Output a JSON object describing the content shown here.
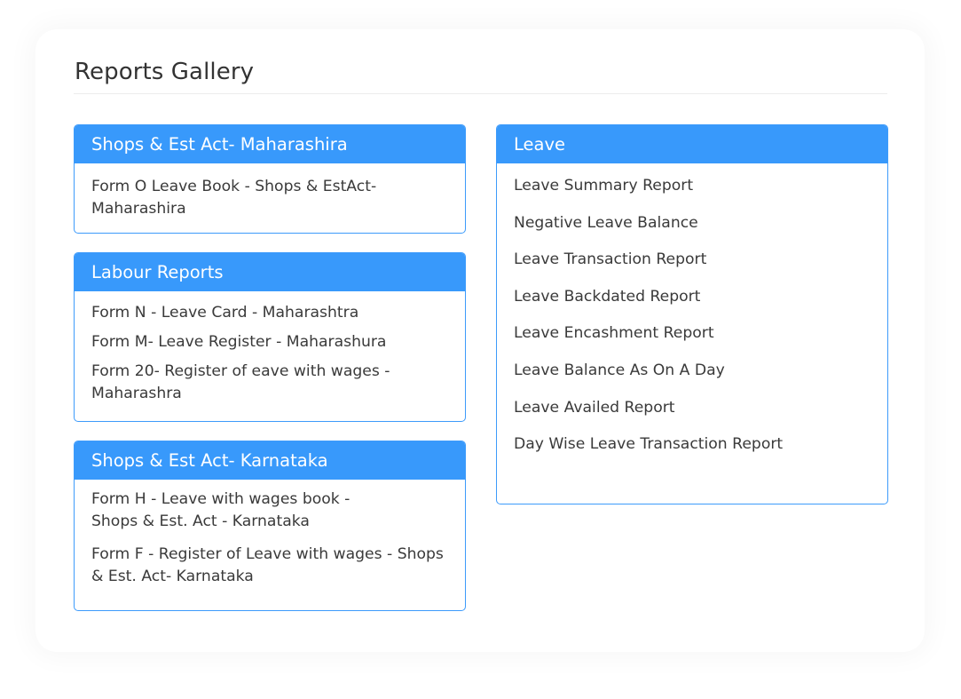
{
  "page": {
    "title": "Reports Gallery"
  },
  "colors": {
    "accent": "#3899fb",
    "border": "#3d9bfb",
    "text": "#3a3a3a"
  },
  "sections": [
    {
      "title": "Shops & Est Act- Maharashira",
      "items": [
        "Form O Leave Book - Shops & EstAct- Maharashira"
      ]
    },
    {
      "title": "Labour Reports",
      "items": [
        "Form N - Leave Card - Maharashtra",
        "Form M- Leave Register - Maharashura",
        "Form 20- Register of eave with wages - Maharashra"
      ]
    },
    {
      "title": "Shops & Est Act- Karnataka",
      "items": [
        "Form H - Leave with wages book - Shops & Est. Act - Karnataka",
        "Form F - Register of Leave with wages - Shops & Est. Act- Karnataka"
      ]
    },
    {
      "title": "Leave",
      "items": [
        "Leave Summary Report",
        "Negative Leave Balance",
        "Leave Transaction Report",
        "Leave Backdated Report",
        "Leave Encashment Report",
        "Leave Balance As On A Day",
        "Leave Availed Report",
        "Day Wise Leave Transaction Report"
      ]
    }
  ]
}
